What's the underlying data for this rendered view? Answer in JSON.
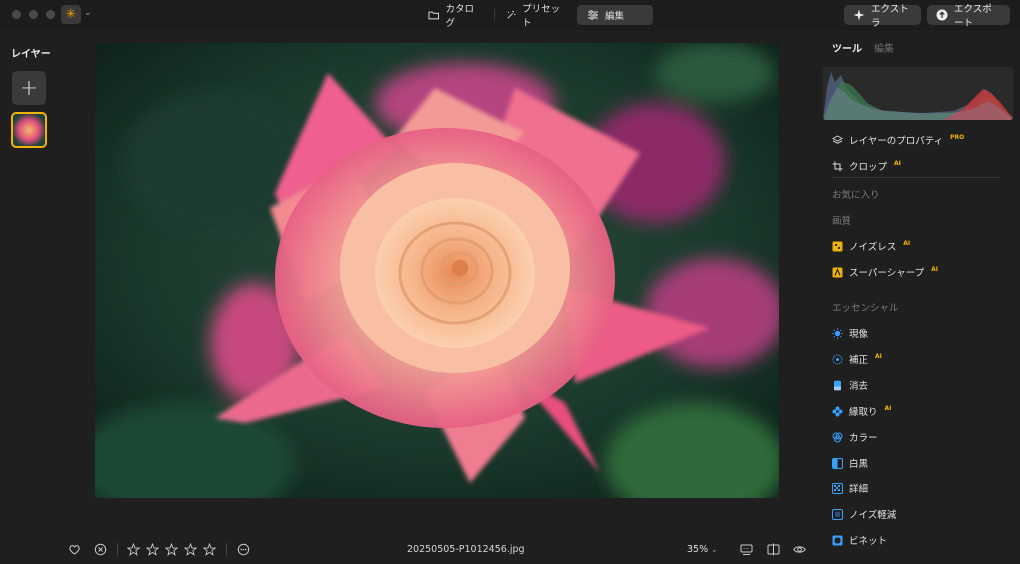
{
  "header": {
    "tabs": [
      {
        "label": "カタログ",
        "icon": "folder-icon"
      },
      {
        "label": "プリセット",
        "icon": "sparkle-wand-icon"
      },
      {
        "label": "編集",
        "icon": "sliders-icon",
        "active": true
      }
    ],
    "extra_label": "エクストラ",
    "export_label": "エクスポート"
  },
  "layers": {
    "title": "レイヤー",
    "add_symbol": "+"
  },
  "right_panel": {
    "tabs": [
      {
        "label": "ツール",
        "active": true
      },
      {
        "label": "編集",
        "active": false
      }
    ],
    "layer_properties": {
      "label": "レイヤーのプロパティ",
      "badge": "PRO"
    },
    "crop": {
      "label": "クロップ",
      "badge": "AI"
    },
    "sections": {
      "favorites": "お気に入り",
      "quality": "画質",
      "essentials": "エッセンシャル"
    },
    "quality_tools": [
      {
        "label": "ノイズレス",
        "badge": "AI",
        "icon": "noiseless-icon"
      },
      {
        "label": "スーパーシャープ",
        "badge": "AI",
        "icon": "supersharp-icon"
      }
    ],
    "essential_tools": [
      {
        "label": "現像",
        "badge": "",
        "icon": "sun-icon"
      },
      {
        "label": "補正",
        "badge": "AI",
        "icon": "enhance-icon"
      },
      {
        "label": "消去",
        "badge": "",
        "icon": "eraser-icon"
      },
      {
        "label": "縁取り",
        "badge": "AI",
        "icon": "flower-icon"
      },
      {
        "label": "カラー",
        "badge": "",
        "icon": "color-icon"
      },
      {
        "label": "白黒",
        "badge": "",
        "icon": "bw-icon"
      },
      {
        "label": "詳細",
        "badge": "",
        "icon": "details-icon"
      },
      {
        "label": "ノイズ軽減",
        "badge": "",
        "icon": "noise-reduction-icon"
      },
      {
        "label": "ビネット",
        "badge": "",
        "icon": "vignette-icon"
      }
    ]
  },
  "footer": {
    "filename": "20250505-P1012456.jpg",
    "zoom": "35%",
    "rating": 0,
    "max_rating": 5
  },
  "colors": {
    "accent": "#f2b300",
    "background": "#1f1f1f",
    "button": "#3a3a3a"
  }
}
